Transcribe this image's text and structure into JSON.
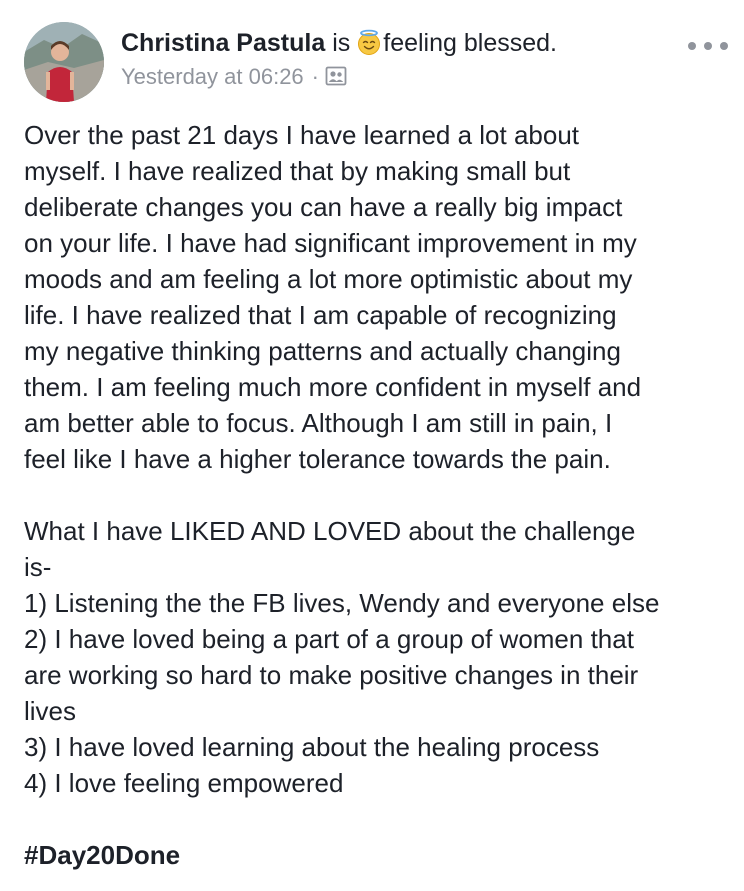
{
  "post": {
    "author": "Christina Pastula",
    "is_word": "is",
    "feeling_icon": "angel-emoji",
    "feeling": "feeling blessed.",
    "timestamp": "Yesterday at 06:26",
    "separator": "·",
    "audience_icon": "group-audience-icon",
    "more_icon": "more-options-icon"
  },
  "body": {
    "paragraph1": [
      "Over the past 21 days I have learned a lot about",
      "myself.  I have realized that by making small but",
      "deliberate changes you can have a really big impact",
      "on your life.  I have had significant improvement in my",
      "moods and am feeling a lot more optimistic about my",
      "life.  I have realized that I am capable of recognizing",
      "my negative thinking patterns and actually changing",
      "them.  I am feeling much more confident in myself and",
      "am better able to focus.  Although I am still in pain, I",
      "feel like I have a higher tolerance towards the pain."
    ],
    "paragraph2": [
      "What I have LIKED AND LOVED about the challenge",
      "is-",
      "1) Listening the the FB lives, Wendy and everyone else",
      "2) I have loved being a part of a group of women that",
      "are working so hard to make positive changes in their",
      "lives",
      "3) I have loved learning about the healing process",
      "4) I love feeling empowered"
    ],
    "hashtag": "#Day20Done"
  }
}
